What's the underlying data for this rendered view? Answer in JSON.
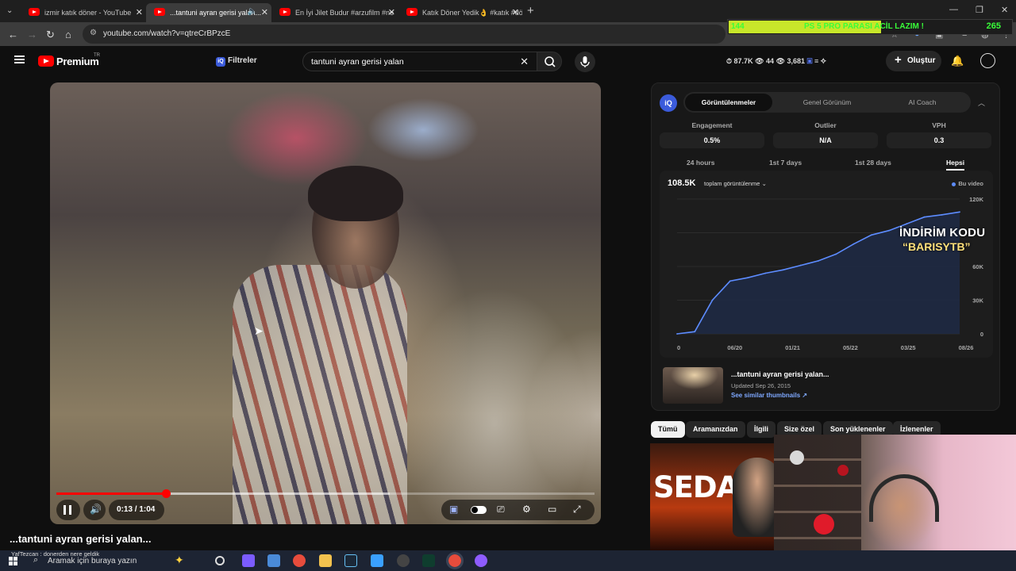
{
  "browser": {
    "tabs": [
      {
        "label": "izmir katık döner - YouTube",
        "active": false,
        "playing_audio": false
      },
      {
        "label": "...tantuni ayran gerisi yalan...",
        "active": true,
        "playing_audio": true
      },
      {
        "label": "En İyi Jilet Budur #arzufilm #ne",
        "active": false,
        "playing_audio": false
      },
      {
        "label": "Katık Döner Yedik👌 #katık #dö",
        "active": false,
        "playing_audio": false
      }
    ],
    "url": "youtube.com/watch?v=qtreCrBPzcE"
  },
  "stream_overlay": {
    "left_value": "144",
    "text": "PS 5 PRO PARASI ACİL LAZIM !",
    "right_value": "265",
    "progress_fraction": 0.54,
    "color": "#39ff39"
  },
  "header": {
    "brand": "Premium",
    "region": "TR",
    "filters_label": "Filtreler",
    "search_value": "tantuni ayran gerisi yalan",
    "stats": [
      "87.7K",
      "44",
      "3,681"
    ],
    "create_label": "Oluştur"
  },
  "player": {
    "time": "0:13 / 1:04",
    "progress_fraction": 0.203,
    "buffer_fraction": 0.62,
    "state": "playing"
  },
  "video": {
    "title": "...tantuni ayran gerisi yalan..."
  },
  "panel": {
    "tabs": [
      "Görüntülenmeler",
      "Genel Görünüm",
      "AI Coach"
    ],
    "selected_tab": 0,
    "metrics": [
      {
        "label": "Engagement",
        "value": "0.5%"
      },
      {
        "label": "Outlier",
        "value": "N/A"
      },
      {
        "label": "VPH",
        "value": "0.3"
      }
    ],
    "ranges": [
      "24 hours",
      "1st 7 days",
      "1st 28 days",
      "Hepsi"
    ],
    "selected_range": 3,
    "total_views": "108.5K",
    "metric_selector": "toplam görüntülenme",
    "legend": "Bu video",
    "promo_line1": "İNDİRİM KODU",
    "promo_line2": "“BARISYTB”",
    "thumb_title": "...tantuni ayran gerisi yalan...",
    "thumb_updated": "Updated Sep 26, 2015",
    "thumb_link": "See similar thumbnails ↗"
  },
  "chart_data": {
    "type": "area",
    "x": [
      "2015-09",
      "2015-10",
      "2016-03",
      "2016-06",
      "2017-01",
      "2018-01",
      "2019-01",
      "2020-01",
      "2020-06",
      "2021-01",
      "2021-06",
      "2022-01",
      "2022-06",
      "2023-01",
      "2024-01",
      "2025-01",
      "2026-08"
    ],
    "series": [
      {
        "name": "Bu video",
        "values": [
          0,
          2000,
          30000,
          47000,
          50000,
          54000,
          57000,
          61000,
          65000,
          71000,
          80000,
          88000,
          92000,
          98000,
          104000,
          106000,
          108500
        ]
      }
    ],
    "x_tick_labels": [
      "0",
      "06/20",
      "01/21",
      "05/22",
      "03/25",
      "08/26"
    ],
    "y_tick_labels": [
      "0",
      "30K",
      "60K",
      "120K"
    ],
    "ylim": [
      0,
      120000
    ],
    "legend_position": "top-right",
    "color": "#5d8cff"
  },
  "chips": [
    "Tümü",
    "Aramanızdan",
    "İlgili",
    "Size özel",
    "Son yüklenenler",
    "İzlenenler"
  ],
  "recommendation": {
    "thumb_text": "SEDAT"
  },
  "taskbar": {
    "notification": "YafTezcan : donerden nere geldik",
    "search_placeholder": "Aramak için buraya yazın"
  }
}
